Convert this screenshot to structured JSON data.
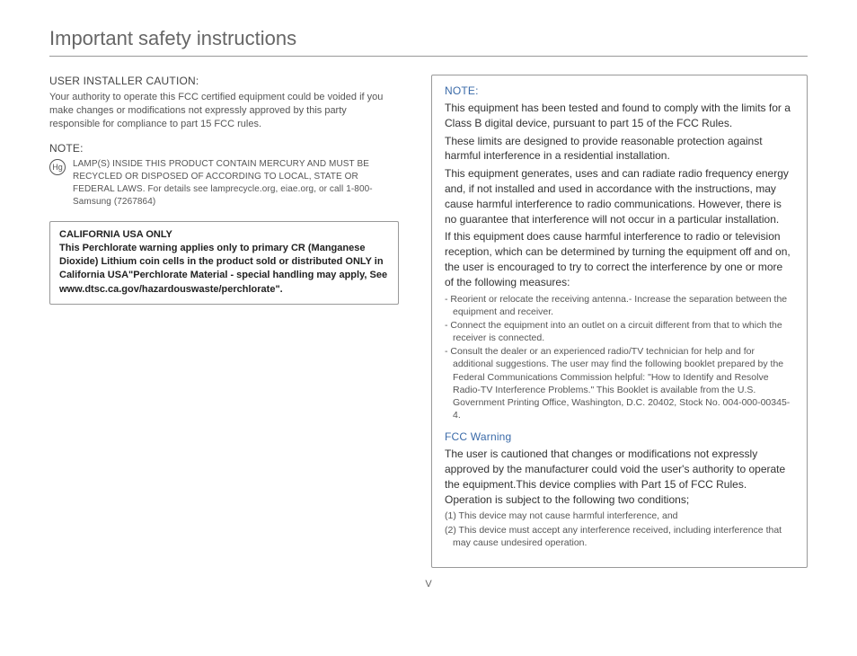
{
  "title": "Important safety instructions",
  "pageNumber": "V",
  "left": {
    "userCaution": {
      "heading": "USER INSTALLER CAUTION:",
      "body": "Your authority to operate this FCC certified equipment could be voided if you make changes or modifications not expressly approved by this party responsible for compliance to part 15 FCC rules."
    },
    "note": {
      "heading": "NOTE:",
      "hgSymbol": "Hg",
      "lampText": "LAMP(S) INSIDE THIS PRODUCT CONTAIN MERCURY AND MUST BE RECYCLED OR DISPOSED OF ACCORDING TO LOCAL, STATE OR FEDERAL LAWS. For details see lamprecycle.org, eiae.org, or call 1-800-Samsung (7267864)"
    },
    "california": {
      "title": "CALIFORNIA USA ONLY",
      "body": "This Perchlorate warning applies only to primary CR (Manganese Dioxide) Lithium coin cells in the product sold or distributed ONLY in California USA\"Perchlorate Material - special handling may apply, See www.dtsc.ca.gov/hazardouswaste/perchlorate\"."
    }
  },
  "right": {
    "note": {
      "heading": "NOTE:",
      "p1": "This equipment has been tested and found to comply with the limits for a Class B digital device, pursuant to part 15 of the FCC Rules.",
      "p2": "These limits are designed to provide reasonable protection against harmful interference in a residential installation.",
      "p3": "This equipment generates, uses and can radiate radio frequency energy and, if not installed and used in accordance with the instructions, may cause harmful interference to radio communications. However, there is no guarantee that interference will not occur in a particular installation.",
      "p4": "If this equipment does cause harmful interference to radio or television reception, which can be determined by turning the equipment off and on, the user is encouraged to try to correct the interference by one or more of the following measures:",
      "bul1": "- Reorient or relocate the receiving antenna.- Increase the separation between the equipment and receiver.",
      "bul2": "- Connect the equipment into an outlet on a circuit different from that to which the receiver is connected.",
      "bul3": "- Consult the dealer or an experienced radio/TV technician for help and for additional suggestions. The user may find the following booklet prepared by the Federal Communications Commission helpful: \"How to Identify and Resolve Radio-TV Interference Problems.\" This Booklet is available from the U.S. Government Printing Office, Washington, D.C. 20402, Stock No. 004-000-00345-4."
    },
    "fcc": {
      "heading": "FCC Warning",
      "body": "The user is cautioned that changes or modifications not expressly approved by the manufacturer could void the user's authority to operate the equipment.This device complies with Part 15 of FCC Rules. Operation is subject to the following two conditions;",
      "c1": "(1) This device may not cause harmful interference, and",
      "c2": "(2) This device must accept any interference received, including interference that may cause undesired operation."
    }
  }
}
